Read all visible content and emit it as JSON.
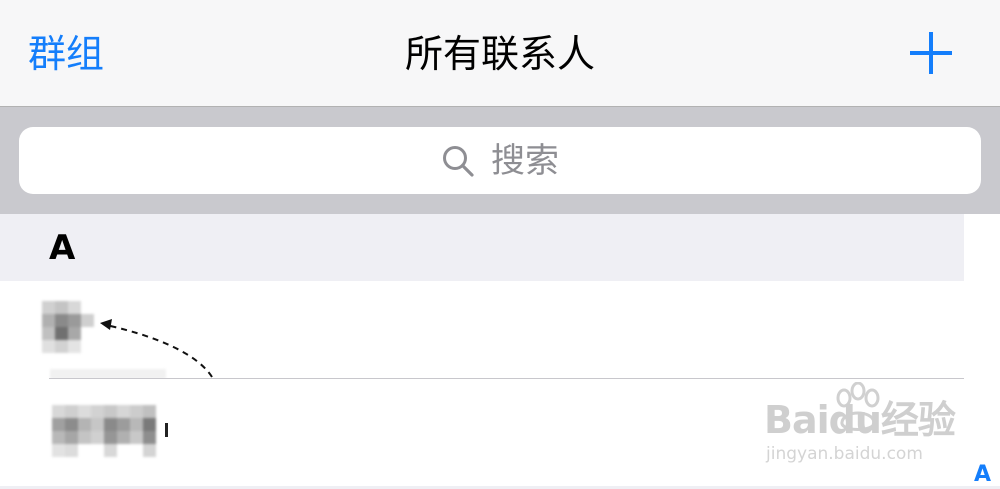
{
  "navbar": {
    "left_label": "群组",
    "title": "所有联系人",
    "add_icon": "plus-icon"
  },
  "search": {
    "placeholder": "搜索",
    "icon": "search-icon"
  },
  "contacts": {
    "sections": [
      {
        "letter": "A",
        "rows": [
          {
            "name": "",
            "note": "obscured name"
          },
          {
            "name": "",
            "note": "obscured name"
          }
        ]
      }
    ]
  },
  "index_bar": {
    "letters": [
      "A"
    ]
  },
  "watermark": {
    "brand": "Baidu经验",
    "url": "jingyan.baidu.com"
  },
  "colors": {
    "accent": "#147efb",
    "navbar_bg": "#f7f7f8",
    "search_bg": "#c9c9ce",
    "section_bg": "#efeff4"
  }
}
